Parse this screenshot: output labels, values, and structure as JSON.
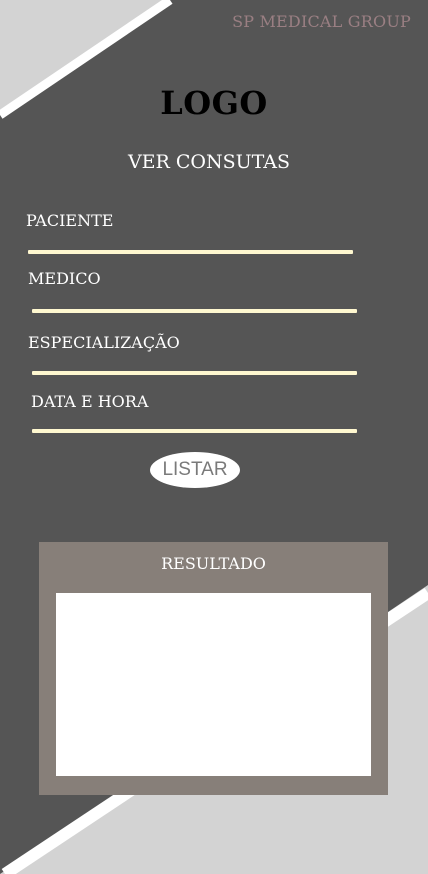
{
  "header": {
    "brand": "SP MEDICAL GROUP",
    "logo": "LOGO"
  },
  "form": {
    "title": "VER CONSUTAS",
    "fields": [
      {
        "label": "PACIENTE"
      },
      {
        "label": "MEDICO"
      },
      {
        "label": "ESPECIALIZAÇÃO"
      },
      {
        "label": "DATA E HORA"
      }
    ],
    "submit_label": "LISTAR"
  },
  "results": {
    "title": "RESULTADO"
  },
  "colors": {
    "background": "#d3d3d3",
    "panel_dark": "#555555",
    "accent_line": "#fff8d0",
    "brand_text": "#9a7f83",
    "result_panel": "#877f79"
  }
}
